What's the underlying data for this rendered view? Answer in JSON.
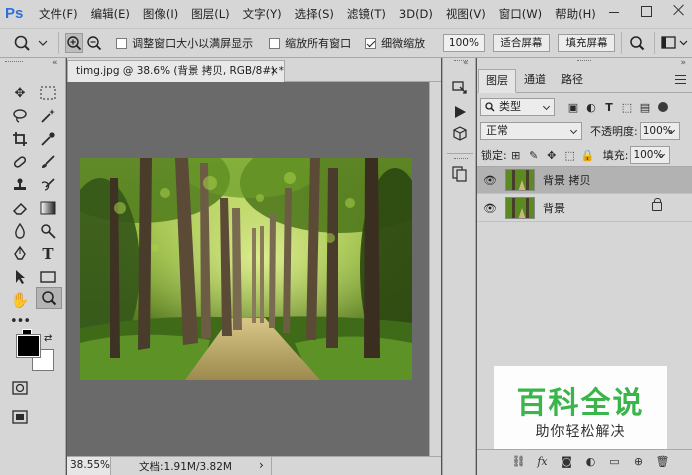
{
  "app": {
    "logo": "Ps"
  },
  "menu": [
    "文件(F)",
    "编辑(E)",
    "图像(I)",
    "图层(L)",
    "文字(Y)",
    "选择(S)",
    "滤镜(T)",
    "3D(D)",
    "视图(V)",
    "窗口(W)",
    "帮助(H)"
  ],
  "options": {
    "resize_windows": "调整窗口大小以满屏显示",
    "zoom_all": "缩放所有窗口",
    "scrubby_zoom": "细微缩放",
    "zoom_value": "100%",
    "fit_screen": "适合屏幕",
    "fill_screen": "填充屏幕",
    "resize_windows_checked": false,
    "zoom_all_checked": false,
    "scrubby_zoom_checked": true
  },
  "document": {
    "tab_title": "timg.jpg @ 38.6% (背景 拷贝, RGB/8#) *",
    "close": "×",
    "zoom": "38.55%",
    "doc_size": "文档:1.91M/3.82M",
    "status_arrow": "›"
  },
  "layers_panel": {
    "tabs": [
      "图层",
      "通道",
      "路径"
    ],
    "filter_kind": "类型",
    "blend_mode": "正常",
    "opacity_label": "不透明度:",
    "opacity_value": "100%",
    "lock_label": "锁定:",
    "fill_label": "填充:",
    "fill_value": "100%",
    "layers": [
      {
        "name": "背景 拷贝",
        "selected": true,
        "locked": false
      },
      {
        "name": "背景",
        "selected": false,
        "locked": true
      }
    ]
  },
  "watermark": {
    "title": "百科全说",
    "subtitle": "助你轻松解决"
  },
  "colors": {
    "chrome": "#d6d6d6",
    "canvas_bg": "#6a6a6a",
    "accent": "#39b54a"
  }
}
